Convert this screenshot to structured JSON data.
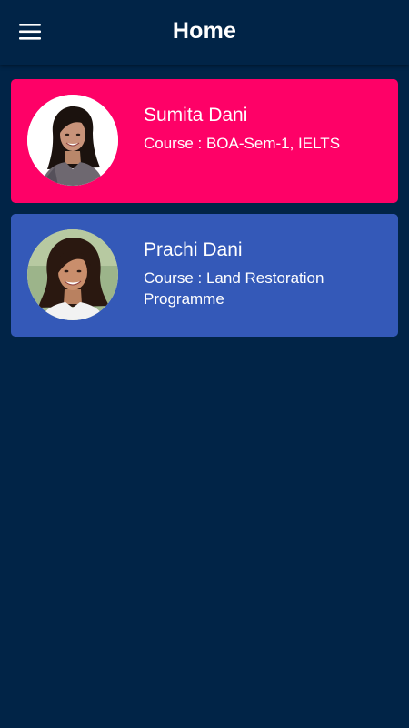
{
  "header": {
    "title": "Home",
    "menu_icon": "hamburger-menu-icon"
  },
  "colors": {
    "background": "#012447",
    "card_1": "#fe0167",
    "card_2": "#3459b8",
    "text": "#ffffff"
  },
  "students": [
    {
      "name": "Sumita Dani",
      "course": "Course : BOA-Sem-1, IELTS"
    },
    {
      "name": "Prachi Dani",
      "course": "Course : Land Restoration Programme"
    }
  ]
}
